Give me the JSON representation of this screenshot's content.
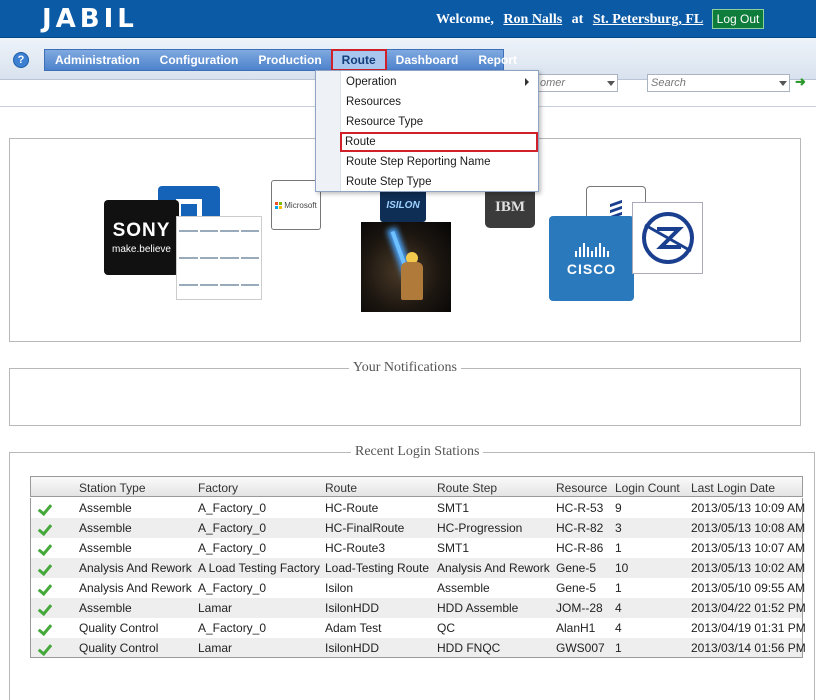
{
  "header": {
    "logo_text": "JABIL",
    "welcome_label": "Welcome,",
    "user_name": "Ron Nalls",
    "at_label": "at",
    "location": "St. Petersburg, FL",
    "logout_label": "Log Out",
    "background_color": "#0b5aa6"
  },
  "nav": {
    "help_icon": "question-circle-icon",
    "items": [
      {
        "label": "Administration"
      },
      {
        "label": "Configuration"
      },
      {
        "label": "Production"
      },
      {
        "label": "Route"
      },
      {
        "label": "Dashboard"
      },
      {
        "label": "Report"
      }
    ],
    "active_item": "Route",
    "highlight_color": "#d0202a"
  },
  "route_menu": {
    "items": [
      {
        "label": "Operation",
        "has_submenu": true
      },
      {
        "label": "Resources"
      },
      {
        "label": "Resource Type"
      },
      {
        "label": "Route"
      },
      {
        "label": "Route Step Reporting Name"
      },
      {
        "label": "Route Step Type"
      }
    ],
    "selected": "Route"
  },
  "filters": {
    "customer_partial": "omer",
    "search_placeholder": "Search",
    "go_icon": "green-arrow-right-icon"
  },
  "logos": {
    "sony_line1": "SONY",
    "sony_line2": "make.believe",
    "microsoft": "Microsoft",
    "isilon": "ISILON",
    "ibm": "IBM",
    "cisco": "CISCO"
  },
  "notifications": {
    "title": "Your Notifications"
  },
  "recent_logins": {
    "title": "Recent Login Stations",
    "columns": [
      "Station Type",
      "Factory",
      "Route",
      "Route Step",
      "Resource",
      "Login Count",
      "Last Login Date"
    ],
    "status_icon": "green-check-icon",
    "rows": [
      {
        "station_type": "Assemble",
        "factory": "A_Factory_0",
        "route": "HC-Route",
        "route_step": "SMT1",
        "resource": "HC-R-53",
        "login_count": "9",
        "last_login": "2013/05/13 10:09 AM"
      },
      {
        "station_type": "Assemble",
        "factory": "A_Factory_0",
        "route": "HC-FinalRoute",
        "route_step": "HC-Progression",
        "resource": "HC-R-82",
        "login_count": "3",
        "last_login": "2013/05/13 10:08 AM"
      },
      {
        "station_type": "Assemble",
        "factory": "A_Factory_0",
        "route": "HC-Route3",
        "route_step": "SMT1",
        "resource": "HC-R-86",
        "login_count": "1",
        "last_login": "2013/05/13 10:07 AM"
      },
      {
        "station_type": "Analysis And Rework",
        "factory": "A Load Testing Factory",
        "route": "Load-Testing Route",
        "route_step": "Analysis And Rework",
        "resource": "Gene-5",
        "login_count": "10",
        "last_login": "2013/05/13 10:02 AM"
      },
      {
        "station_type": "Analysis And Rework",
        "factory": "A_Factory_0",
        "route": "Isilon",
        "route_step": "Assemble",
        "resource": "Gene-5",
        "login_count": "1",
        "last_login": "2013/05/10 09:55 AM"
      },
      {
        "station_type": "Assemble",
        "factory": "Lamar",
        "route": "IsilonHDD",
        "route_step": "HDD Assemble",
        "resource": "JOM--28",
        "login_count": "4",
        "last_login": "2013/04/22 01:52 PM"
      },
      {
        "station_type": "Quality Control",
        "factory": "A_Factory_0",
        "route": "Adam Test",
        "route_step": "QC",
        "resource": "AlanH1",
        "login_count": "4",
        "last_login": "2013/04/19 01:31 PM"
      },
      {
        "station_type": "Quality Control",
        "factory": "Lamar",
        "route": "IsilonHDD",
        "route_step": "HDD FNQC",
        "resource": "GWS007",
        "login_count": "1",
        "last_login": "2013/03/14 01:56 PM"
      }
    ]
  }
}
